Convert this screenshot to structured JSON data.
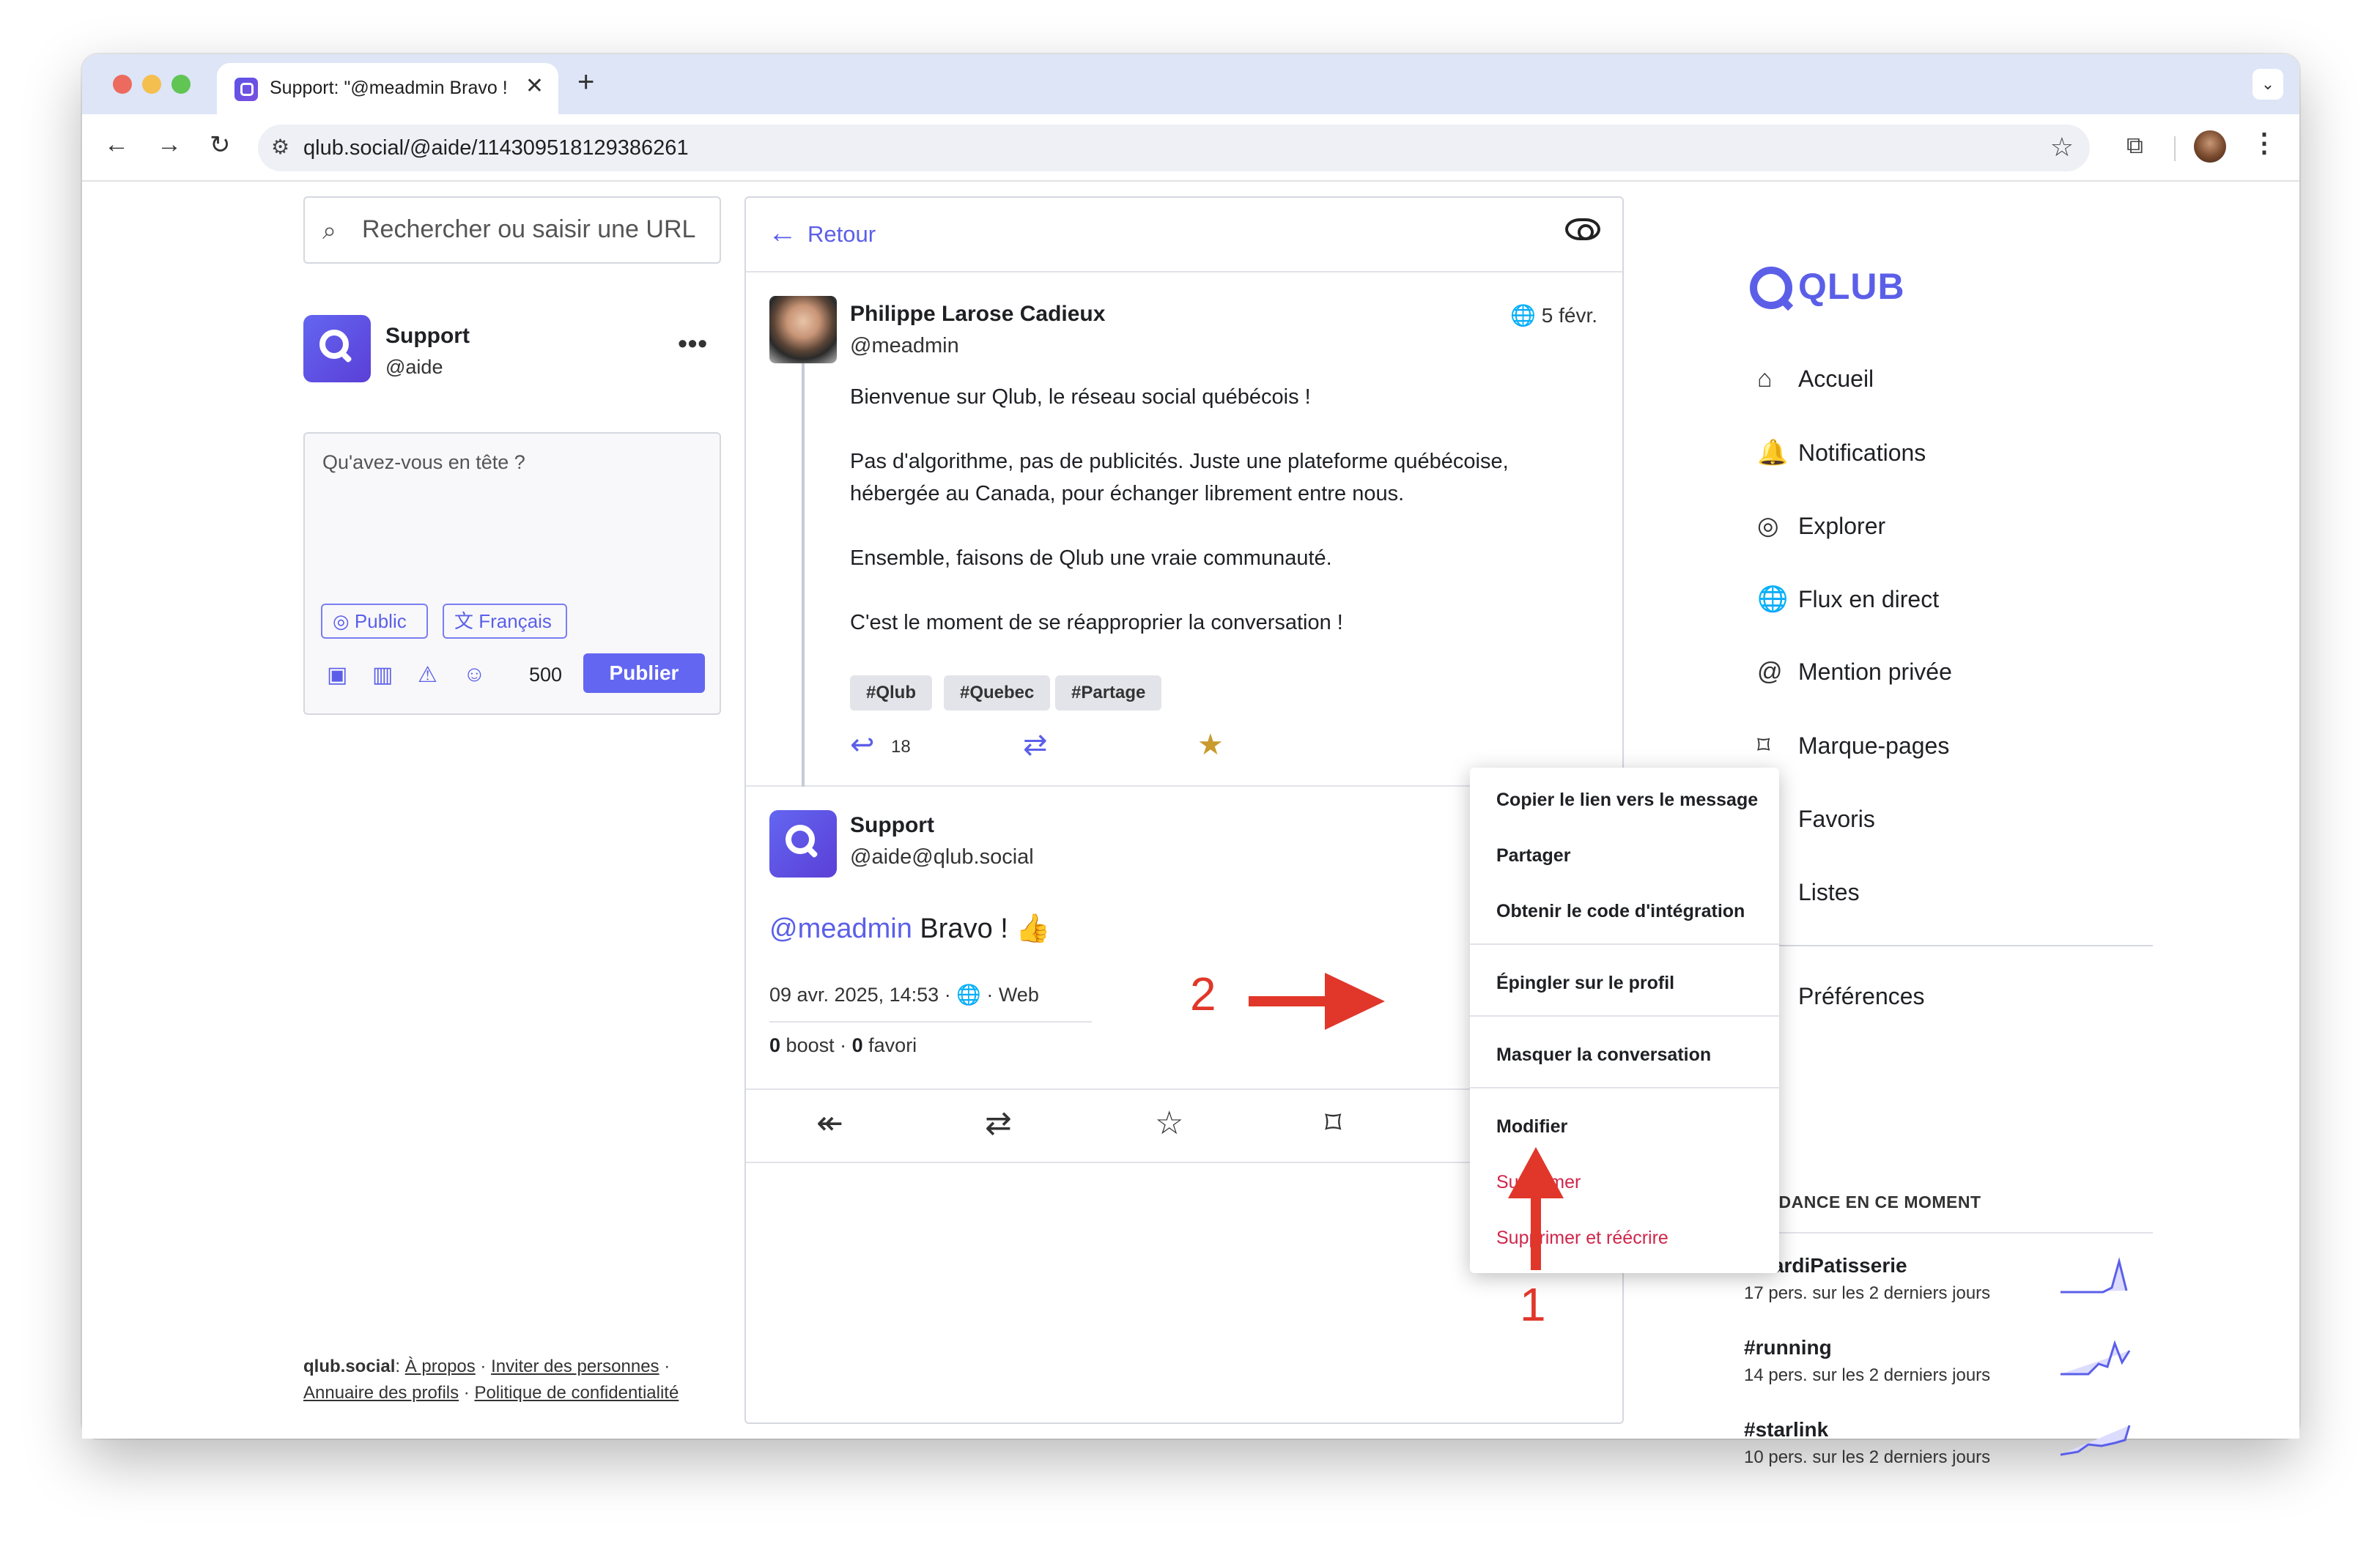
{
  "browser": {
    "tab_title": "Support: \"@meadmin Bravo !",
    "url": "qlub.social/@aide/114309518129386261"
  },
  "search": {
    "placeholder": "Rechercher ou saisir une URL"
  },
  "account": {
    "name": "Support",
    "handle": "@aide"
  },
  "composer": {
    "placeholder": "Qu'avez-vous en tête ?",
    "visibility": "Public",
    "language": "Français",
    "char_count": "500",
    "publish_label": "Publier"
  },
  "footer": {
    "site": "qlub.social",
    "links": [
      "À propos",
      "Inviter des personnes",
      "Annuaire des profils",
      "Politique de confidentialité"
    ]
  },
  "thread": {
    "back_label": "Retour",
    "post1": {
      "author": "Philippe Larose Cadieux",
      "handle": "@meadmin",
      "date": "5 févr.",
      "paragraphs": [
        "Bienvenue sur Qlub, le réseau social québécois !",
        "Pas d'algorithme, pas de publicités. Juste une plateforme québécoise, hébergée au Canada, pour échanger librement entre nous.",
        "Ensemble, faisons de Qlub une vraie communauté.",
        "C'est le moment de se réapproprier la conversation !"
      ],
      "tags": [
        "#Qlub",
        "#Quebec",
        "#Partage"
      ],
      "reply_count": "18"
    },
    "post2": {
      "author": "Support",
      "handle": "@aide@qlub.social",
      "mention": "@meadmin",
      "text": " Bravo ! 👍",
      "datetime": "09 avr. 2025, 14:53",
      "app": "Web",
      "boost_count": "0",
      "boost_label": "boost",
      "fav_count": "0",
      "fav_label": "favori"
    }
  },
  "dropdown": {
    "items": [
      "Copier le lien vers le message",
      "Partager",
      "Obtenir le code d'intégration",
      "Épingler sur le profil",
      "Masquer la conversation",
      "Modifier",
      "Supprimer",
      "Supprimer et réécrire"
    ]
  },
  "nav": {
    "logo": "QLUB",
    "items": [
      {
        "label": "Accueil",
        "icon": "home-icon"
      },
      {
        "label": "Notifications",
        "icon": "bell-icon"
      },
      {
        "label": "Explorer",
        "icon": "compass-icon"
      },
      {
        "label": "Flux en direct",
        "icon": "globe-icon"
      },
      {
        "label": "Mention privée",
        "icon": "at-icon"
      },
      {
        "label": "Marque-pages",
        "icon": "bookmark-icon"
      },
      {
        "label": "Favoris",
        "icon": "star-icon"
      },
      {
        "label": "Listes",
        "icon": "list-icon"
      },
      {
        "label": "Préférences",
        "icon": "gear-icon"
      }
    ]
  },
  "trending": {
    "heading": "TENDANCE EN CE MOMENT",
    "items": [
      {
        "tag": "#MardiPatisserie",
        "sub": "17 pers. sur les 2 derniers jours"
      },
      {
        "tag": "#running",
        "sub": "14 pers. sur les 2 derniers jours"
      },
      {
        "tag": "#starlink",
        "sub": "10 pers. sur les 2 derniers jours"
      }
    ]
  },
  "annotations": {
    "step1": "1",
    "step2": "2"
  },
  "colors": {
    "accent": "#5b5fe8",
    "danger": "#d0264a",
    "annotation": "#e0372a",
    "favourite": "#c99a2e"
  }
}
